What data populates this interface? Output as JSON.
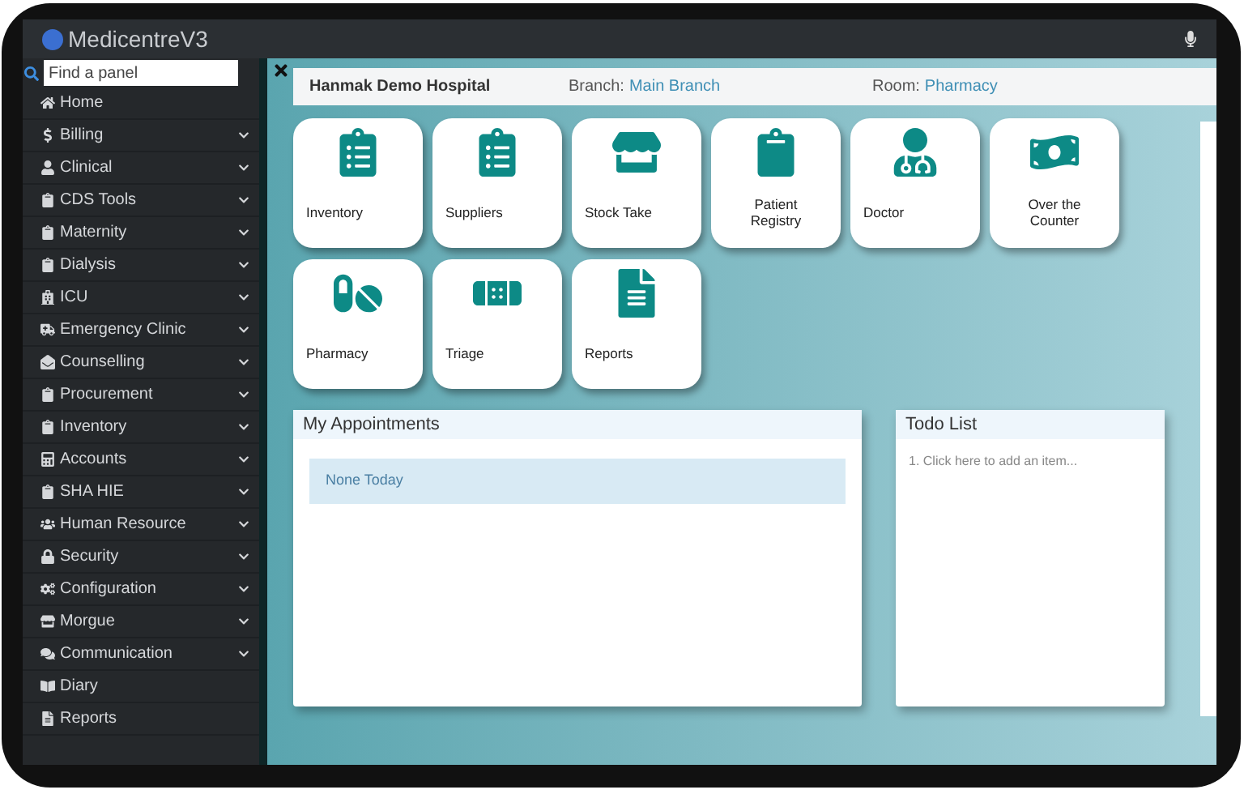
{
  "app": {
    "title": "MedicentreV3"
  },
  "search": {
    "placeholder": "Find a panel"
  },
  "sidebar": {
    "items": [
      {
        "label": "Home",
        "kind": "link"
      },
      {
        "label": "Billing",
        "kind": "group"
      },
      {
        "label": "Clinical",
        "kind": "group"
      },
      {
        "label": "CDS Tools",
        "kind": "group"
      },
      {
        "label": "Maternity",
        "kind": "group"
      },
      {
        "label": "Dialysis",
        "kind": "group"
      },
      {
        "label": "ICU",
        "kind": "group"
      },
      {
        "label": "Emergency Clinic",
        "kind": "group"
      },
      {
        "label": "Counselling",
        "kind": "group"
      },
      {
        "label": "Procurement",
        "kind": "group"
      },
      {
        "label": "Inventory",
        "kind": "group"
      },
      {
        "label": "Accounts",
        "kind": "group"
      },
      {
        "label": "SHA HIE",
        "kind": "group"
      },
      {
        "label": "Human Resource",
        "kind": "group"
      },
      {
        "label": "Security",
        "kind": "group"
      },
      {
        "label": "Configuration",
        "kind": "group"
      },
      {
        "label": "Morgue",
        "kind": "group"
      },
      {
        "label": "Communication",
        "kind": "group"
      },
      {
        "label": "Diary",
        "kind": "link"
      },
      {
        "label": "Reports",
        "kind": "link"
      }
    ]
  },
  "header": {
    "hospital": "Hanmak Demo Hospital",
    "branch_label": "Branch:",
    "branch": "Main Branch",
    "room_label": "Room:",
    "room": "Pharmacy"
  },
  "tiles": [
    {
      "label": "Inventory"
    },
    {
      "label": "Suppliers"
    },
    {
      "label": "Stock Take"
    },
    {
      "label": "Patient Registry"
    },
    {
      "label": "Doctor"
    },
    {
      "label": "Over the Counter"
    },
    {
      "label": "Pharmacy"
    },
    {
      "label": "Triage"
    },
    {
      "label": "Reports"
    }
  ],
  "appointments": {
    "title": "My Appointments",
    "message": "None Today"
  },
  "todo": {
    "title": "Todo List",
    "placeholder": "1. Click here to add an item..."
  }
}
